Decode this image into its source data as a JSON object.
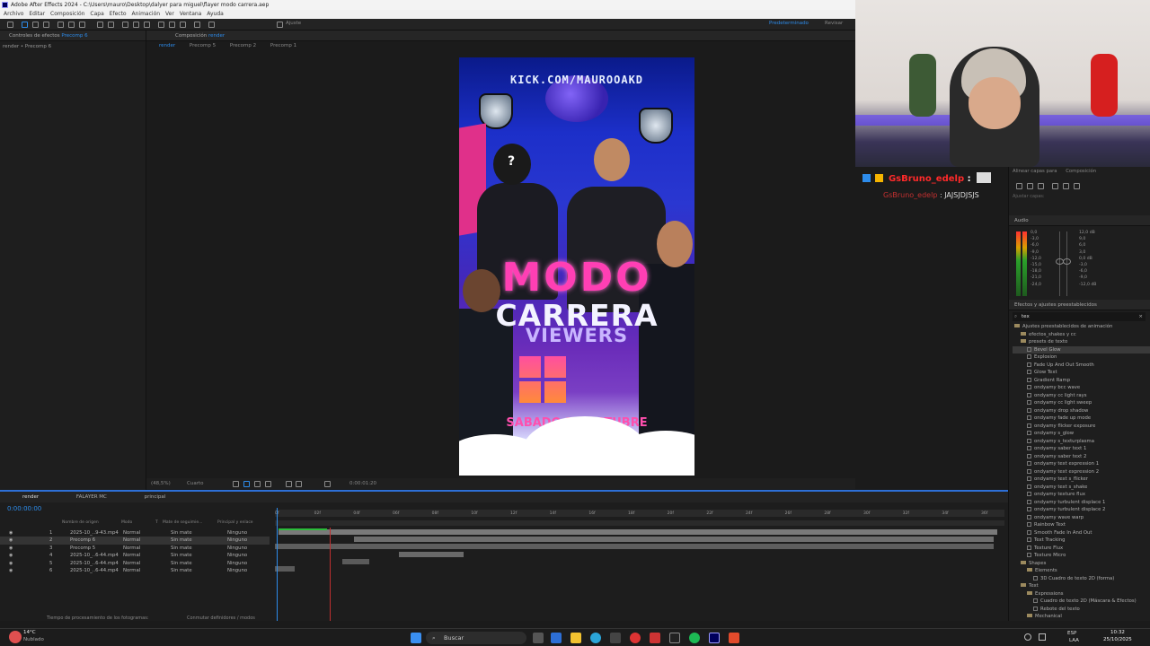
{
  "window": {
    "title": "Adobe After Effects 2024 - C:\\Users\\mauro\\Desktop\\dalyer para miguel\\flayer modo carrera.aep",
    "menu": [
      "Archivo",
      "Editar",
      "Composición",
      "Capa",
      "Efecto",
      "Animación",
      "Ver",
      "Ventana",
      "Ayuda"
    ]
  },
  "toolbar": {
    "snap_label": "Ajuste",
    "workspace": "Predeterminado",
    "review": "Revisar"
  },
  "effect_controls": {
    "tab": "Controles de efectos",
    "tab_target": "Precomp 6",
    "subtitle": "render • Precomp 6"
  },
  "composition": {
    "tab": "Composición",
    "tab_target": "render",
    "breadcrumbs": [
      "render",
      "Precomp 5",
      "Precomp 2",
      "Precomp 1"
    ],
    "zoom": "(48,5%)",
    "resolution": "Cuarto",
    "time": "0:00:01:20"
  },
  "poster": {
    "url": "KICK.COM/MAUROOAKD",
    "title1": "MODO",
    "title2": "CARRERA",
    "title3": "VIEWERS",
    "date": "SABADO 25 OCTUBRE",
    "question": "?"
  },
  "chat": {
    "user1": "GsBruno_edelp",
    "user2": "GsBruno_edelp",
    "msg2": "JAJSJDJSJS"
  },
  "right_panel": {
    "tabs": [
      "Alinear capas para",
      "Composición"
    ],
    "extra": "Ajustar capas:",
    "audio_title": "Audio",
    "audio_scale": [
      "0,0",
      "-3,0",
      "-6,0",
      "-9,0",
      "-12,0",
      "-15,0",
      "-18,0",
      "-21,0",
      "-24,0"
    ],
    "audio_scale_right": [
      "12,0 dB",
      "9,0",
      "6,0",
      "3,0",
      "0,0 dB",
      "-3,0",
      "-6,0",
      "-9,0",
      "-12,0 dB"
    ],
    "effects_title": "Efectos y ajustes preestablecidos",
    "search_value": "tex",
    "tree": [
      {
        "label": "Ajustes preestablecidos de animación",
        "indent": 0,
        "kind": "folder"
      },
      {
        "label": "efectos_shakes y cc",
        "indent": 1,
        "kind": "folder"
      },
      {
        "label": "presets de texto",
        "indent": 1,
        "kind": "folder"
      },
      {
        "label": "Bevel Glow",
        "indent": 2,
        "kind": "item",
        "selected": true
      },
      {
        "label": "Explosion",
        "indent": 2,
        "kind": "item"
      },
      {
        "label": "Fade Up And Out Smooth",
        "indent": 2,
        "kind": "item"
      },
      {
        "label": "Glow Text",
        "indent": 2,
        "kind": "item"
      },
      {
        "label": "Gradient Ramp",
        "indent": 2,
        "kind": "item"
      },
      {
        "label": "ondyamy bcc wave",
        "indent": 2,
        "kind": "item"
      },
      {
        "label": "ondyamy cc light rays",
        "indent": 2,
        "kind": "item"
      },
      {
        "label": "ondyamy cc light sweep",
        "indent": 2,
        "kind": "item"
      },
      {
        "label": "ondyamy drop shadow",
        "indent": 2,
        "kind": "item"
      },
      {
        "label": "ondyamy fade up mode",
        "indent": 2,
        "kind": "item"
      },
      {
        "label": "ondyamy flicker exposure",
        "indent": 2,
        "kind": "item"
      },
      {
        "label": "ondyamy s_glow",
        "indent": 2,
        "kind": "item"
      },
      {
        "label": "ondyamy s_texturplasma",
        "indent": 2,
        "kind": "item"
      },
      {
        "label": "ondyamy saber text 1",
        "indent": 2,
        "kind": "item"
      },
      {
        "label": "ondyamy saber text 2",
        "indent": 2,
        "kind": "item"
      },
      {
        "label": "ondyamy text expression 1",
        "indent": 2,
        "kind": "item"
      },
      {
        "label": "ondyamy text expression 2",
        "indent": 2,
        "kind": "item"
      },
      {
        "label": "ondyamy text s_flicker",
        "indent": 2,
        "kind": "item"
      },
      {
        "label": "ondyamy text s_shake",
        "indent": 2,
        "kind": "item"
      },
      {
        "label": "ondyamy texture flux",
        "indent": 2,
        "kind": "item"
      },
      {
        "label": "ondyamy turbulent displace 1",
        "indent": 2,
        "kind": "item"
      },
      {
        "label": "ondyamy turbulent displace 2",
        "indent": 2,
        "kind": "item"
      },
      {
        "label": "ondyamy wave warp",
        "indent": 2,
        "kind": "item"
      },
      {
        "label": "Rainbow Text",
        "indent": 2,
        "kind": "item"
      },
      {
        "label": "Smooth Fade In And Out",
        "indent": 2,
        "kind": "item"
      },
      {
        "label": "Text Tracking",
        "indent": 2,
        "kind": "item"
      },
      {
        "label": "Texture Flux",
        "indent": 2,
        "kind": "item"
      },
      {
        "label": "Texture Micro",
        "indent": 2,
        "kind": "item"
      },
      {
        "label": "Shapes",
        "indent": 1,
        "kind": "folder"
      },
      {
        "label": "Elements",
        "indent": 2,
        "kind": "folder"
      },
      {
        "label": "3D Cuadro de texto 2D (forma)",
        "indent": 3,
        "kind": "item"
      },
      {
        "label": "Text",
        "indent": 1,
        "kind": "folder"
      },
      {
        "label": "Expressions",
        "indent": 2,
        "kind": "folder"
      },
      {
        "label": "Cuadro de texto 2D (Máscara & Efectos)",
        "indent": 3,
        "kind": "item"
      },
      {
        "label": "Rebote del texto",
        "indent": 3,
        "kind": "item"
      },
      {
        "label": "Mechanical",
        "indent": 2,
        "kind": "folder"
      }
    ]
  },
  "timeline": {
    "tabs": [
      "render",
      "FALAYER MC",
      "principal"
    ],
    "timecode": "0:00:00:00",
    "col_headers": [
      "Nombre de origen",
      "Modo",
      "T",
      "Mate de seguimie...",
      "Principal y enlace"
    ],
    "ticks": [
      "0f",
      "02f",
      "04f",
      "06f",
      "08f",
      "10f",
      "12f",
      "14f",
      "16f",
      "18f",
      "20f",
      "22f",
      "24f",
      "26f",
      "28f",
      "30f",
      "32f",
      "34f",
      "36f"
    ],
    "layers": [
      {
        "num": "1",
        "name": "2025-10_..9-43.mp4",
        "mode": "Normal",
        "matte": "Sin mate",
        "parent": "Ninguno"
      },
      {
        "num": "2",
        "name": "Precomp 6",
        "mode": "Normal",
        "matte": "Sin mate",
        "parent": "Ninguno"
      },
      {
        "num": "3",
        "name": "Precomp 5",
        "mode": "Normal",
        "matte": "Sin mate",
        "parent": "Ninguno"
      },
      {
        "num": "4",
        "name": "2025-10_..6-44.mp4",
        "mode": "Normal",
        "matte": "Sin mate",
        "parent": "Ninguno"
      },
      {
        "num": "5",
        "name": "2025-10_..6-44.mp4",
        "mode": "Normal",
        "matte": "Sin mate",
        "parent": "Ninguno"
      },
      {
        "num": "6",
        "name": "2025-10_..6-44.mp4",
        "mode": "Normal",
        "matte": "Sin mate",
        "parent": "Ninguno"
      }
    ],
    "status_left": "Tiempo de procesamiento de los fotogramas:",
    "status_mid": "Conmutar definidores / modos"
  },
  "taskbar": {
    "weather_temp": "14°C",
    "weather_text": "Nublado",
    "search": "Buscar",
    "lang": "ESP",
    "lang2": "LAA",
    "clock": "10:32",
    "date": "25/10/2025"
  }
}
